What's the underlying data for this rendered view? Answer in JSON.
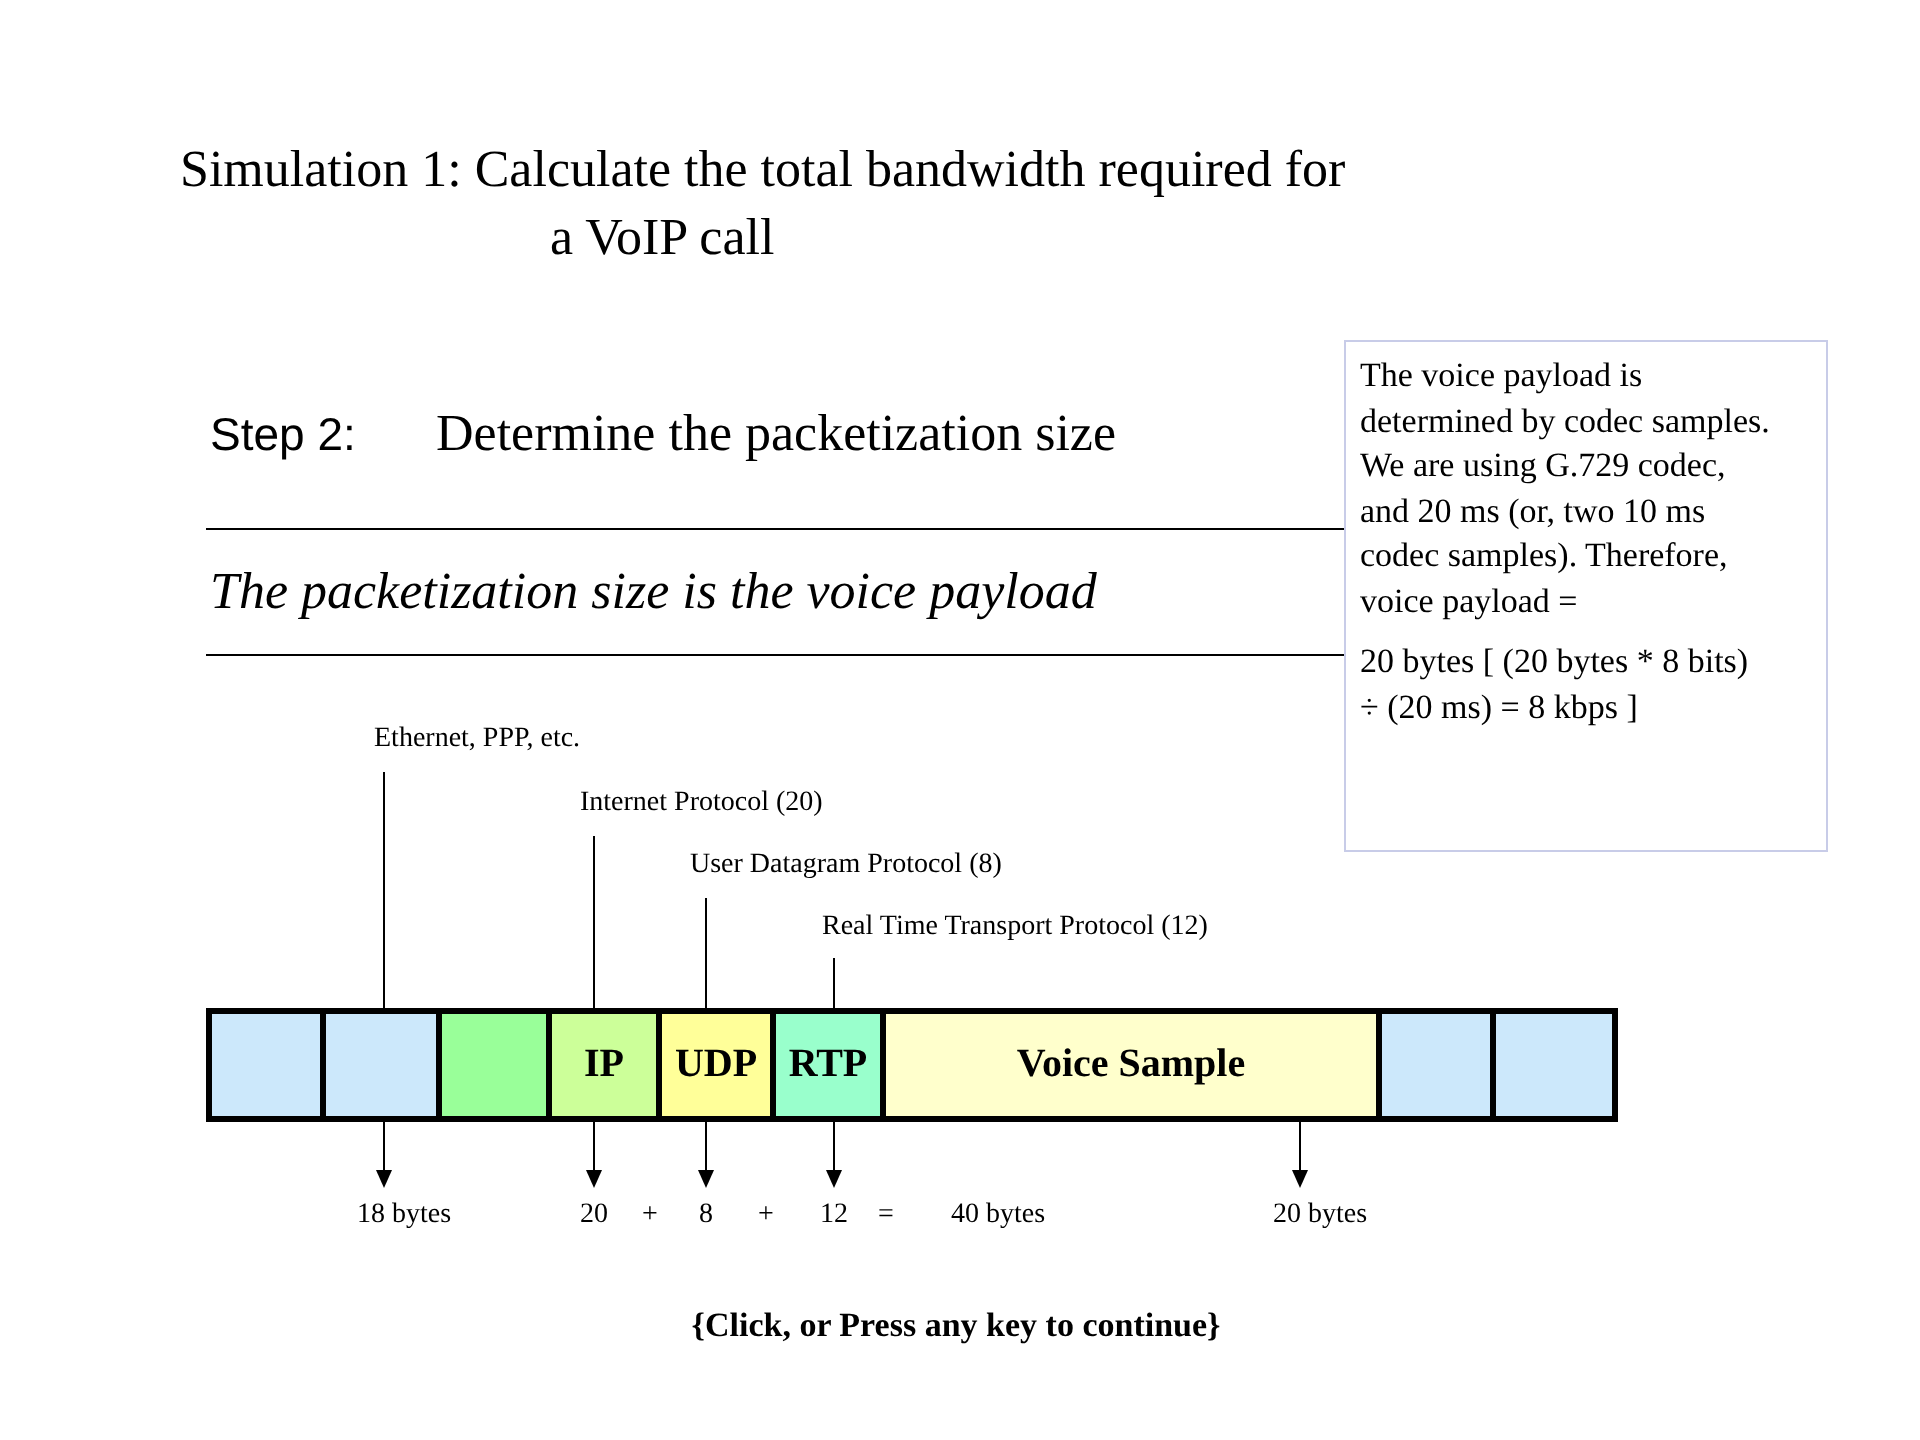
{
  "title_lines": [
    "Simulation 1: Calculate the total bandwidth required for",
    "a VoIP call"
  ],
  "step": {
    "label": "Step 2:",
    "text": "Determine the packetization size"
  },
  "statement": "The packetization size is the voice payload",
  "note": {
    "paragraphs": [
      "The voice payload is determined by codec samples. We are using G.729 codec, and 20 ms (or, two 10 ms codec samples). Therefore, voice payload =",
      "20 bytes [ (20 bytes * 8 bits) ÷ (20 ms) = 8 kbps ]"
    ]
  },
  "diagram": {
    "header_labels": [
      "Ethernet, PPP, etc.",
      "Internet Protocol (20)",
      "User Datagram Protocol (8)",
      "Real Time Transport Protocol (12)"
    ],
    "segments": [
      {
        "color": "#cce8fb"
      },
      {
        "color": "#cce8fb"
      },
      {
        "color": "#99ff99"
      },
      {
        "label": "IP",
        "color": "#ccff99"
      },
      {
        "label": "UDP",
        "color": "#ffff99"
      },
      {
        "label": "RTP",
        "color": "#99ffcc"
      },
      {
        "label": "Voice Sample",
        "color": "#ffffcc"
      },
      {
        "color": "#cce8fb"
      },
      {
        "color": "#cce8fb"
      }
    ],
    "byte_labels": [
      "18 bytes",
      "20",
      "+",
      "8",
      "+",
      "12",
      "=",
      "40 bytes",
      "20 bytes"
    ]
  },
  "footer": "{Click, or Press any key to continue}"
}
